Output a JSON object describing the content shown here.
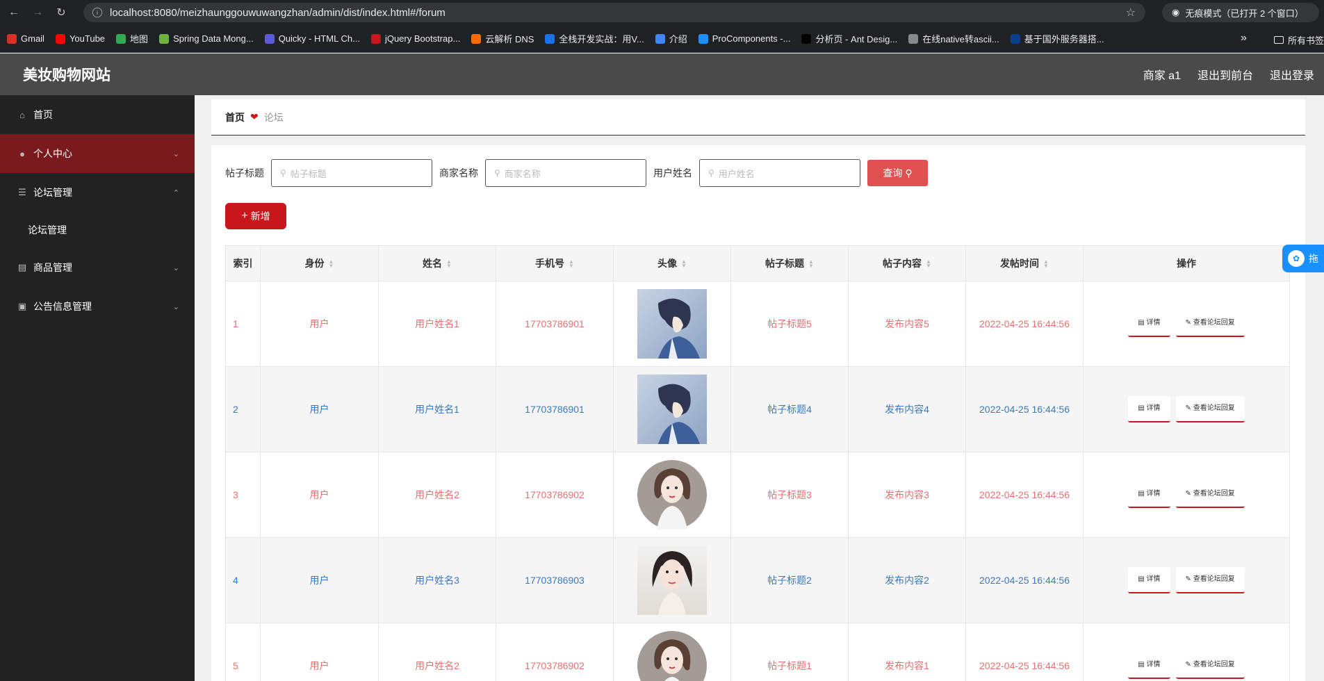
{
  "browser": {
    "url": "localhost:8080/meizhaunggouwuwangzhan/admin/dist/index.html#/forum",
    "incognito_text": "无痕模式（已打开 2 个窗口）",
    "bookmarks": [
      {
        "label": "Gmail",
        "color": "#d93025",
        "icon": "gmail-icon"
      },
      {
        "label": "YouTube",
        "color": "#ff0000",
        "icon": "youtube-icon"
      },
      {
        "label": "地图",
        "color": "#34a853",
        "icon": "maps-icon"
      },
      {
        "label": "Spring Data Mong...",
        "color": "#6db33f",
        "icon": "spring-icon"
      },
      {
        "label": "Quicky - HTML Ch...",
        "color": "#5b5bd6",
        "icon": "quicky-icon"
      },
      {
        "label": "jQuery Bootstrap...",
        "color": "#c8161d",
        "icon": "jquery-icon"
      },
      {
        "label": "云解析 DNS",
        "color": "#ff6a00",
        "icon": "aliyun-icon"
      },
      {
        "label": "全栈开发实战：用V...",
        "color": "#1a73e8",
        "icon": "m-icon"
      },
      {
        "label": "介绍",
        "color": "#4285f4",
        "icon": "intro-icon"
      },
      {
        "label": "ProComponents -...",
        "color": "#1890ff",
        "icon": "antd-icon"
      },
      {
        "label": "分析页 - Ant Desig...",
        "color": "#000000",
        "icon": "pro-icon"
      },
      {
        "label": "在线native转ascii...",
        "color": "#888888",
        "icon": "globe-icon"
      },
      {
        "label": "基于国外服务器搭...",
        "color": "#0b3d91",
        "icon": "flag-icon"
      }
    ],
    "all_bookmarks": "所有书签"
  },
  "header": {
    "title": "美妆购物网站",
    "user": "商家 a1",
    "to_front": "退出到前台",
    "logout": "退出登录"
  },
  "sidebar": {
    "items": [
      {
        "label": "首页",
        "icon": "home-icon"
      },
      {
        "label": "个人中心",
        "icon": "user-icon"
      },
      {
        "label": "论坛管理",
        "icon": "list-icon"
      },
      {
        "label": "论坛管理"
      },
      {
        "label": "商品管理",
        "icon": "briefcase-icon"
      },
      {
        "label": "公告信息管理",
        "icon": "message-icon"
      }
    ]
  },
  "breadcrumb": {
    "home": "首页",
    "current": "论坛"
  },
  "search": {
    "title_label": "帖子标题",
    "title_placeholder": "帖子标题",
    "merchant_label": "商家名称",
    "merchant_placeholder": "商家名称",
    "user_label": "用户姓名",
    "user_placeholder": "用户姓名",
    "query_button": "查询"
  },
  "add_button": "新增",
  "table": {
    "headers": [
      "索引",
      "身份",
      "姓名",
      "手机号",
      "头像",
      "帖子标题",
      "帖子内容",
      "发帖时间",
      "操作"
    ],
    "rows": [
      {
        "index": "1",
        "role": "用户",
        "name": "用户姓名1",
        "phone": "17703786901",
        "avatar": "anime-boy",
        "title": "帖子标题5",
        "content": "发布内容5",
        "time": "2022-04-25 16:44:56"
      },
      {
        "index": "2",
        "role": "用户",
        "name": "用户姓名1",
        "phone": "17703786901",
        "avatar": "anime-boy",
        "title": "帖子标题4",
        "content": "发布内容4",
        "time": "2022-04-25 16:44:56"
      },
      {
        "index": "3",
        "role": "用户",
        "name": "用户姓名2",
        "phone": "17703786902",
        "avatar": "girl-circle",
        "title": "帖子标题3",
        "content": "发布内容3",
        "time": "2022-04-25 16:44:56"
      },
      {
        "index": "4",
        "role": "用户",
        "name": "用户姓名3",
        "phone": "17703786903",
        "avatar": "woman-photo",
        "title": "帖子标题2",
        "content": "发布内容2",
        "time": "2022-04-25 16:44:56"
      },
      {
        "index": "5",
        "role": "用户",
        "name": "用户姓名2",
        "phone": "17703786902",
        "avatar": "girl-circle",
        "title": "帖子标题1",
        "content": "发布内容1",
        "time": "2022-04-25 16:44:56"
      }
    ],
    "detail_btn": "详情",
    "reply_btn": "查看论坛回复"
  },
  "floating": {
    "label": "拖"
  },
  "colors": {
    "accent": "#c8161d",
    "sidebar_bg": "#222222",
    "active_menu": "#7a1a1c",
    "header_bg": "#4a4a4a",
    "odd_text": "#e87070",
    "even_text": "#3a78c0",
    "query_btn": "#e05050"
  }
}
